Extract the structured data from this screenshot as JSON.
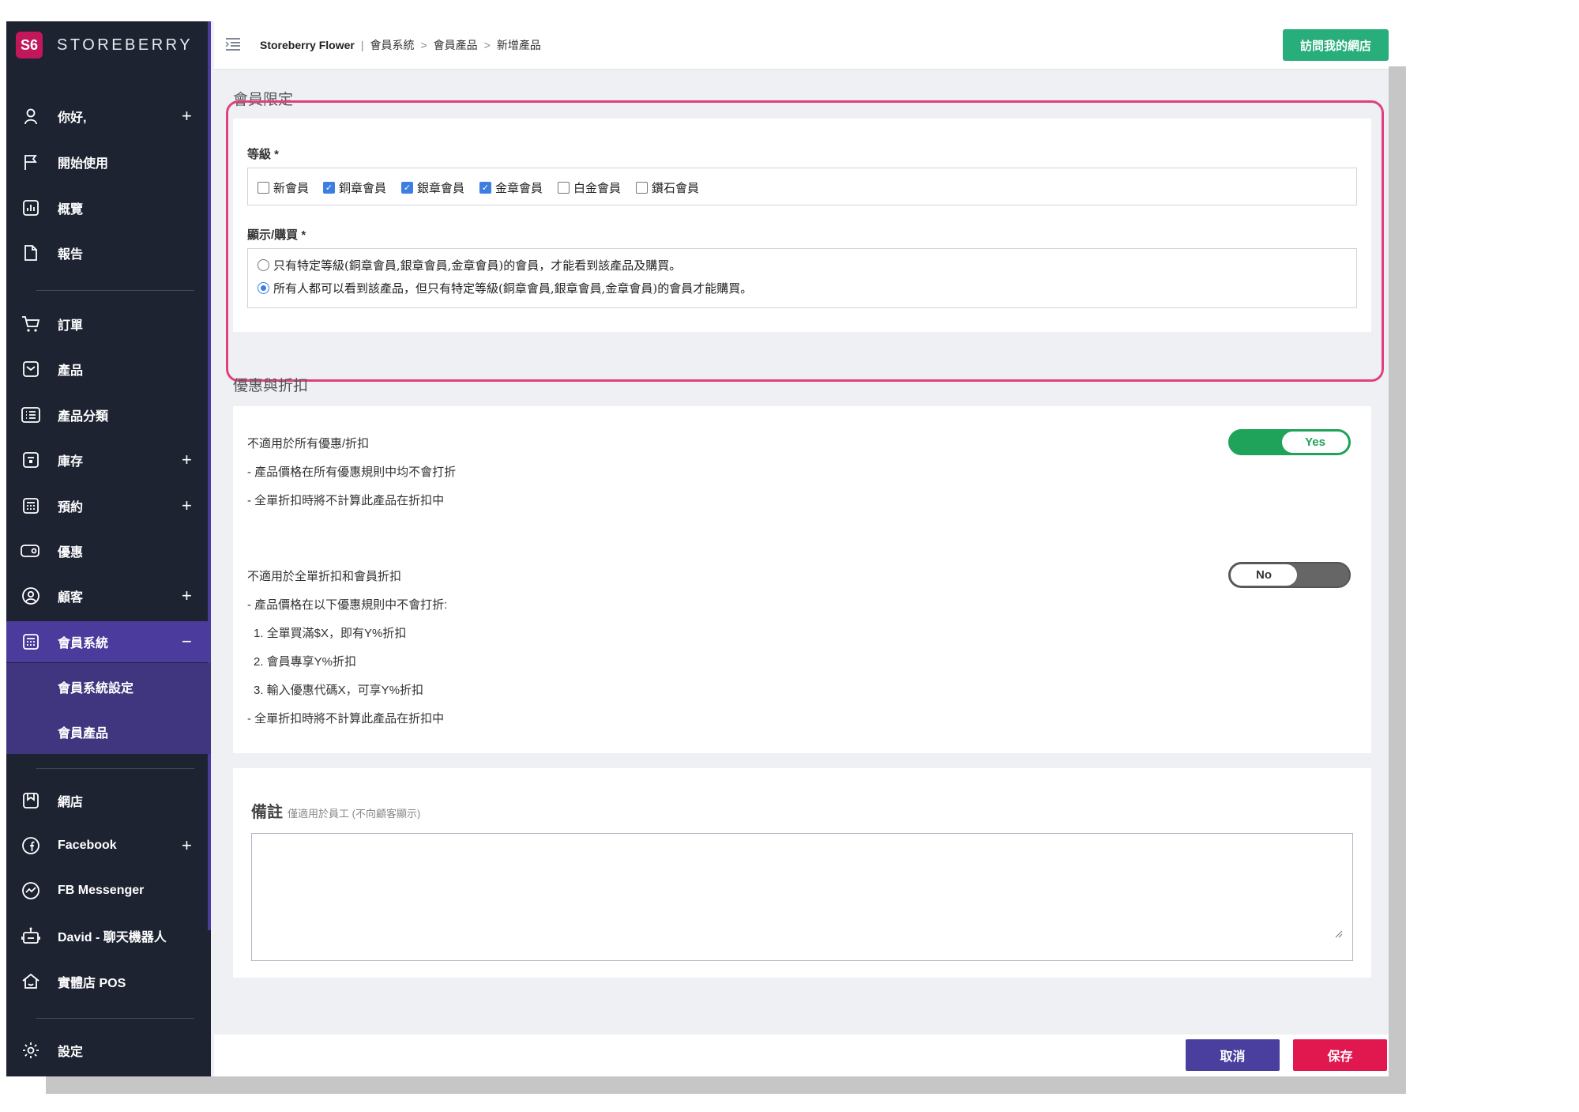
{
  "brand": {
    "logo": "S6",
    "name": "STOREBERRY"
  },
  "sidebar": {
    "items": [
      {
        "label": "你好,",
        "icon": "user-icon",
        "has_plus": true
      },
      {
        "label": "開始使用",
        "icon": "flag-icon",
        "has_plus": false
      },
      {
        "label": "概覽",
        "icon": "chart-icon",
        "has_plus": false
      },
      {
        "label": "報告",
        "icon": "document-icon",
        "has_plus": false
      },
      {
        "label": "訂單",
        "icon": "cart-icon",
        "has_plus": false
      },
      {
        "label": "產品",
        "icon": "product-icon",
        "has_plus": false
      },
      {
        "label": "產品分類",
        "icon": "list-icon",
        "has_plus": false
      },
      {
        "label": "庫存",
        "icon": "inventory-icon",
        "has_plus": true
      },
      {
        "label": "預約",
        "icon": "calendar-icon",
        "has_plus": true
      },
      {
        "label": "優惠",
        "icon": "ticket-icon",
        "has_plus": false
      },
      {
        "label": "顧客",
        "icon": "customer-icon",
        "has_plus": true
      },
      {
        "label": "會員系統",
        "icon": "member-icon",
        "has_plus": false,
        "expanded_symbol": "−"
      },
      {
        "label": "會員系統設定",
        "sub": true
      },
      {
        "label": "會員產品",
        "sub": true
      },
      {
        "label": "網店",
        "icon": "shop-icon",
        "has_plus": false
      },
      {
        "label": "Facebook",
        "icon": "facebook-icon",
        "has_plus": true
      },
      {
        "label": "FB Messenger",
        "icon": "messenger-icon",
        "has_plus": false
      },
      {
        "label": "David - 聊天機器人",
        "icon": "robot-icon",
        "has_plus": false
      },
      {
        "label": "實體店 POS",
        "icon": "store-icon",
        "has_plus": false
      },
      {
        "label": "設定",
        "icon": "gear-icon",
        "has_plus": false
      }
    ],
    "plus_symbol": "+"
  },
  "header": {
    "store": "Storeberry Flower",
    "sep": "|",
    "crumb1": "會員系統",
    "crumb2": "會員產品",
    "crumb3": "新增產品",
    "arrow": ">",
    "visit_label": "訪問我的網店"
  },
  "member_section": {
    "title": "會員限定",
    "level_label": "等級 *",
    "levels": [
      {
        "label": "新會員",
        "checked": false
      },
      {
        "label": "銅章會員",
        "checked": true
      },
      {
        "label": "銀章會員",
        "checked": true
      },
      {
        "label": "金章會員",
        "checked": true
      },
      {
        "label": "白金會員",
        "checked": false
      },
      {
        "label": "鑽石會員",
        "checked": false
      }
    ],
    "display_label": "顯示/購買 *",
    "options": [
      {
        "label": "只有特定等級(銅章會員,銀章會員,金章會員)的會員，才能看到該產品及購買。",
        "selected": false
      },
      {
        "label": "所有人都可以看到該產品，但只有特定等級(銅章會員,銀章會員,金章會員)的會員才能購買。",
        "selected": true
      }
    ]
  },
  "discount_section": {
    "title": "優惠與折扣",
    "rule1": {
      "title": "不適用於所有優惠/折扣",
      "lines": [
        "- 產品價格在所有優惠規則中均不會打折",
        "- 全單折扣時將不計算此產品在折扣中"
      ],
      "toggle": "Yes"
    },
    "rule2": {
      "title": "不適用於全單折扣和會員折扣",
      "lines": [
        "- 產品價格在以下優惠規則中不會打折:",
        "1. 全單買滿$X，即有Y%折扣",
        "2. 會員專享Y%折扣",
        "3. 輸入優惠代碼X，可享Y%折扣",
        "- 全單折扣時將不計算此產品在折扣中"
      ],
      "toggle": "No"
    }
  },
  "notes": {
    "title": "備註",
    "hint": "僅適用於員工 (不向顧客顯示)",
    "value": ""
  },
  "footer": {
    "cancel": "取消",
    "save": "保存"
  }
}
